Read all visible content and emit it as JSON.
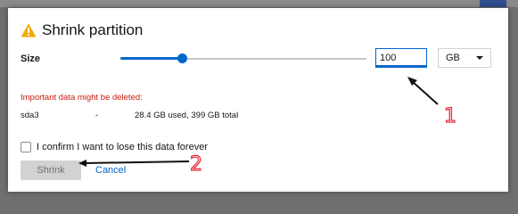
{
  "dialog": {
    "title": "Shrink partition",
    "title_icon": "warning-triangle-icon",
    "size_label": "Size",
    "slider": {
      "fraction": 0.25
    },
    "size_input": {
      "value": "100"
    },
    "unit_select": {
      "value": "GB"
    },
    "warning_text": "Important data might be deleted:",
    "device": {
      "name": "sda3",
      "separator": "-",
      "usage": "28.4 GB used, 399 GB total"
    },
    "confirm_label": "I confirm I want to lose this data forever",
    "shrink_label": "Shrink",
    "cancel_label": "Cancel"
  },
  "annotations": [
    {
      "label": "1",
      "target": "size-input"
    },
    {
      "label": "2",
      "target": "shrink-button"
    }
  ],
  "colors": {
    "accent": "#0066cc",
    "warning_icon": "#f0ab00",
    "danger_text": "#c9190b",
    "annotation_red": "#e8323c",
    "disabled_button": "#d2d2d2"
  }
}
